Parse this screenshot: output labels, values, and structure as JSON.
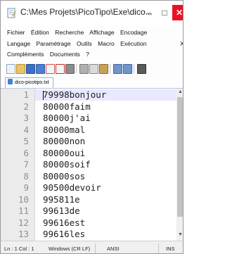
{
  "window": {
    "title": "C:\\Mes Projets\\PicoTipo\\Exe\\dico...",
    "minimize": "–",
    "maximize": "□",
    "close": "✕"
  },
  "menu": {
    "row1": [
      "Fichier",
      "Édition",
      "Recherche",
      "Affichage",
      "Encodage"
    ],
    "row2": [
      "Langage",
      "Paramétrage",
      "Outils",
      "Macro",
      "Exécution"
    ],
    "row3": [
      "Compléments",
      "Documents",
      "?"
    ],
    "overflow": "X"
  },
  "toolbar": {
    "icons": [
      "new-file-icon",
      "open-file-icon",
      "save-icon",
      "save-all-icon",
      "close-file-icon",
      "close-all-icon",
      "print-icon",
      "cut-icon",
      "copy-icon",
      "paste-icon",
      "undo-icon",
      "redo-icon",
      "find-icon"
    ]
  },
  "tabs": [
    {
      "label": "dico-picotipo.txt",
      "close": "⊠"
    }
  ],
  "editor": {
    "lines": [
      {
        "num": "1",
        "text": "79998bonjour"
      },
      {
        "num": "2",
        "text": "80000faim"
      },
      {
        "num": "3",
        "text": "80000j'ai"
      },
      {
        "num": "4",
        "text": "80000mal"
      },
      {
        "num": "5",
        "text": "80000non"
      },
      {
        "num": "6",
        "text": "80000oui"
      },
      {
        "num": "7",
        "text": "80000soif"
      },
      {
        "num": "8",
        "text": "80000sos"
      },
      {
        "num": "9",
        "text": "90500devoir"
      },
      {
        "num": "10",
        "text": "995811e"
      },
      {
        "num": "11",
        "text": "99613de"
      },
      {
        "num": "12",
        "text": "99616est"
      },
      {
        "num": "13",
        "text": "99616les"
      }
    ]
  },
  "status": {
    "position": "Ln : 1   Col : 1",
    "eol": "Windows (CR LF)",
    "encoding": "ANSI",
    "mode": "INS"
  },
  "colors": {
    "close_button": "#e81123",
    "current_line": "#e8e8ff",
    "gutter": "#ebebeb"
  }
}
